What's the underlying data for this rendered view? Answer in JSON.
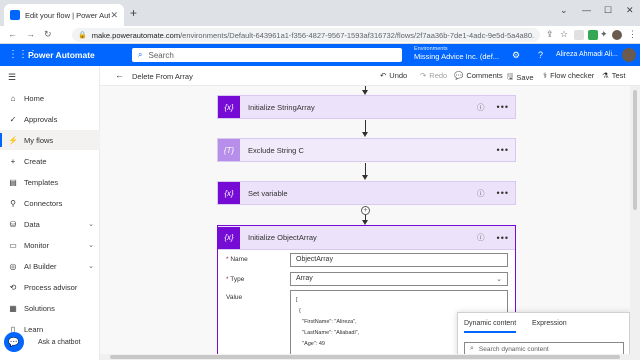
{
  "browser": {
    "tab_title": "Edit your flow | Power Automate",
    "url_host": "make.powerautomate.com",
    "url_path": "/environments/Default-643961a1-f356-4827-9567-1593af316732/flows/2f7aa36b-7de1-4adc-9e5d-5a4a80..."
  },
  "header": {
    "app_title": "Power Automate",
    "search_placeholder": "Search",
    "env_label": "Environments",
    "env_name": "Missing Advice Inc. (def...",
    "user_name": "Alireza Ahmadi Ali..."
  },
  "sidebar": {
    "items": [
      {
        "label": "Home",
        "icon": "home-icon"
      },
      {
        "label": "Approvals",
        "icon": "approvals-icon"
      },
      {
        "label": "My flows",
        "icon": "my-flows-icon"
      },
      {
        "label": "Create",
        "icon": "plus-icon"
      },
      {
        "label": "Templates",
        "icon": "templates-icon"
      },
      {
        "label": "Connectors",
        "icon": "connectors-icon"
      },
      {
        "label": "Data",
        "icon": "data-icon"
      },
      {
        "label": "Monitor",
        "icon": "monitor-icon"
      },
      {
        "label": "AI Builder",
        "icon": "ai-builder-icon"
      },
      {
        "label": "Process advisor",
        "icon": "process-advisor-icon"
      },
      {
        "label": "Solutions",
        "icon": "solutions-icon"
      },
      {
        "label": "Learn",
        "icon": "learn-icon"
      }
    ],
    "chatbot_label": "Ask a chatbot"
  },
  "commandbar": {
    "flow_name": "Delete From Array",
    "undo": "Undo",
    "redo": "Redo",
    "comments": "Comments",
    "save": "Save",
    "flow_checker": "Flow checker",
    "test": "Test"
  },
  "canvas": {
    "cards": [
      {
        "title": "Initialize StringArray",
        "icon_text": "{x}"
      },
      {
        "title": "Exclude String C",
        "icon_text": "{T}"
      },
      {
        "title": "Set variable",
        "icon_text": "{x}"
      }
    ],
    "open_card": {
      "title": "Initialize ObjectArray",
      "icon_text": "{x}",
      "name_label": "Name",
      "name_value": "ObjectArray",
      "type_label": "Type",
      "type_value": "Array",
      "value_label": "Value",
      "value_json": "[\n  {\n    \"FirstName\": \"Alireza\",\n    \"LastName\": \"Aliabadi\",\n    \"Age\": 49"
    }
  },
  "dynamic_panel": {
    "tab_dynamic": "Dynamic content",
    "tab_expression": "Expression",
    "search_placeholder": "Search dynamic content"
  },
  "colors": {
    "brand": "#0066ff",
    "variable_purple": "#770bd6",
    "card_bg": "#ece3fa"
  }
}
